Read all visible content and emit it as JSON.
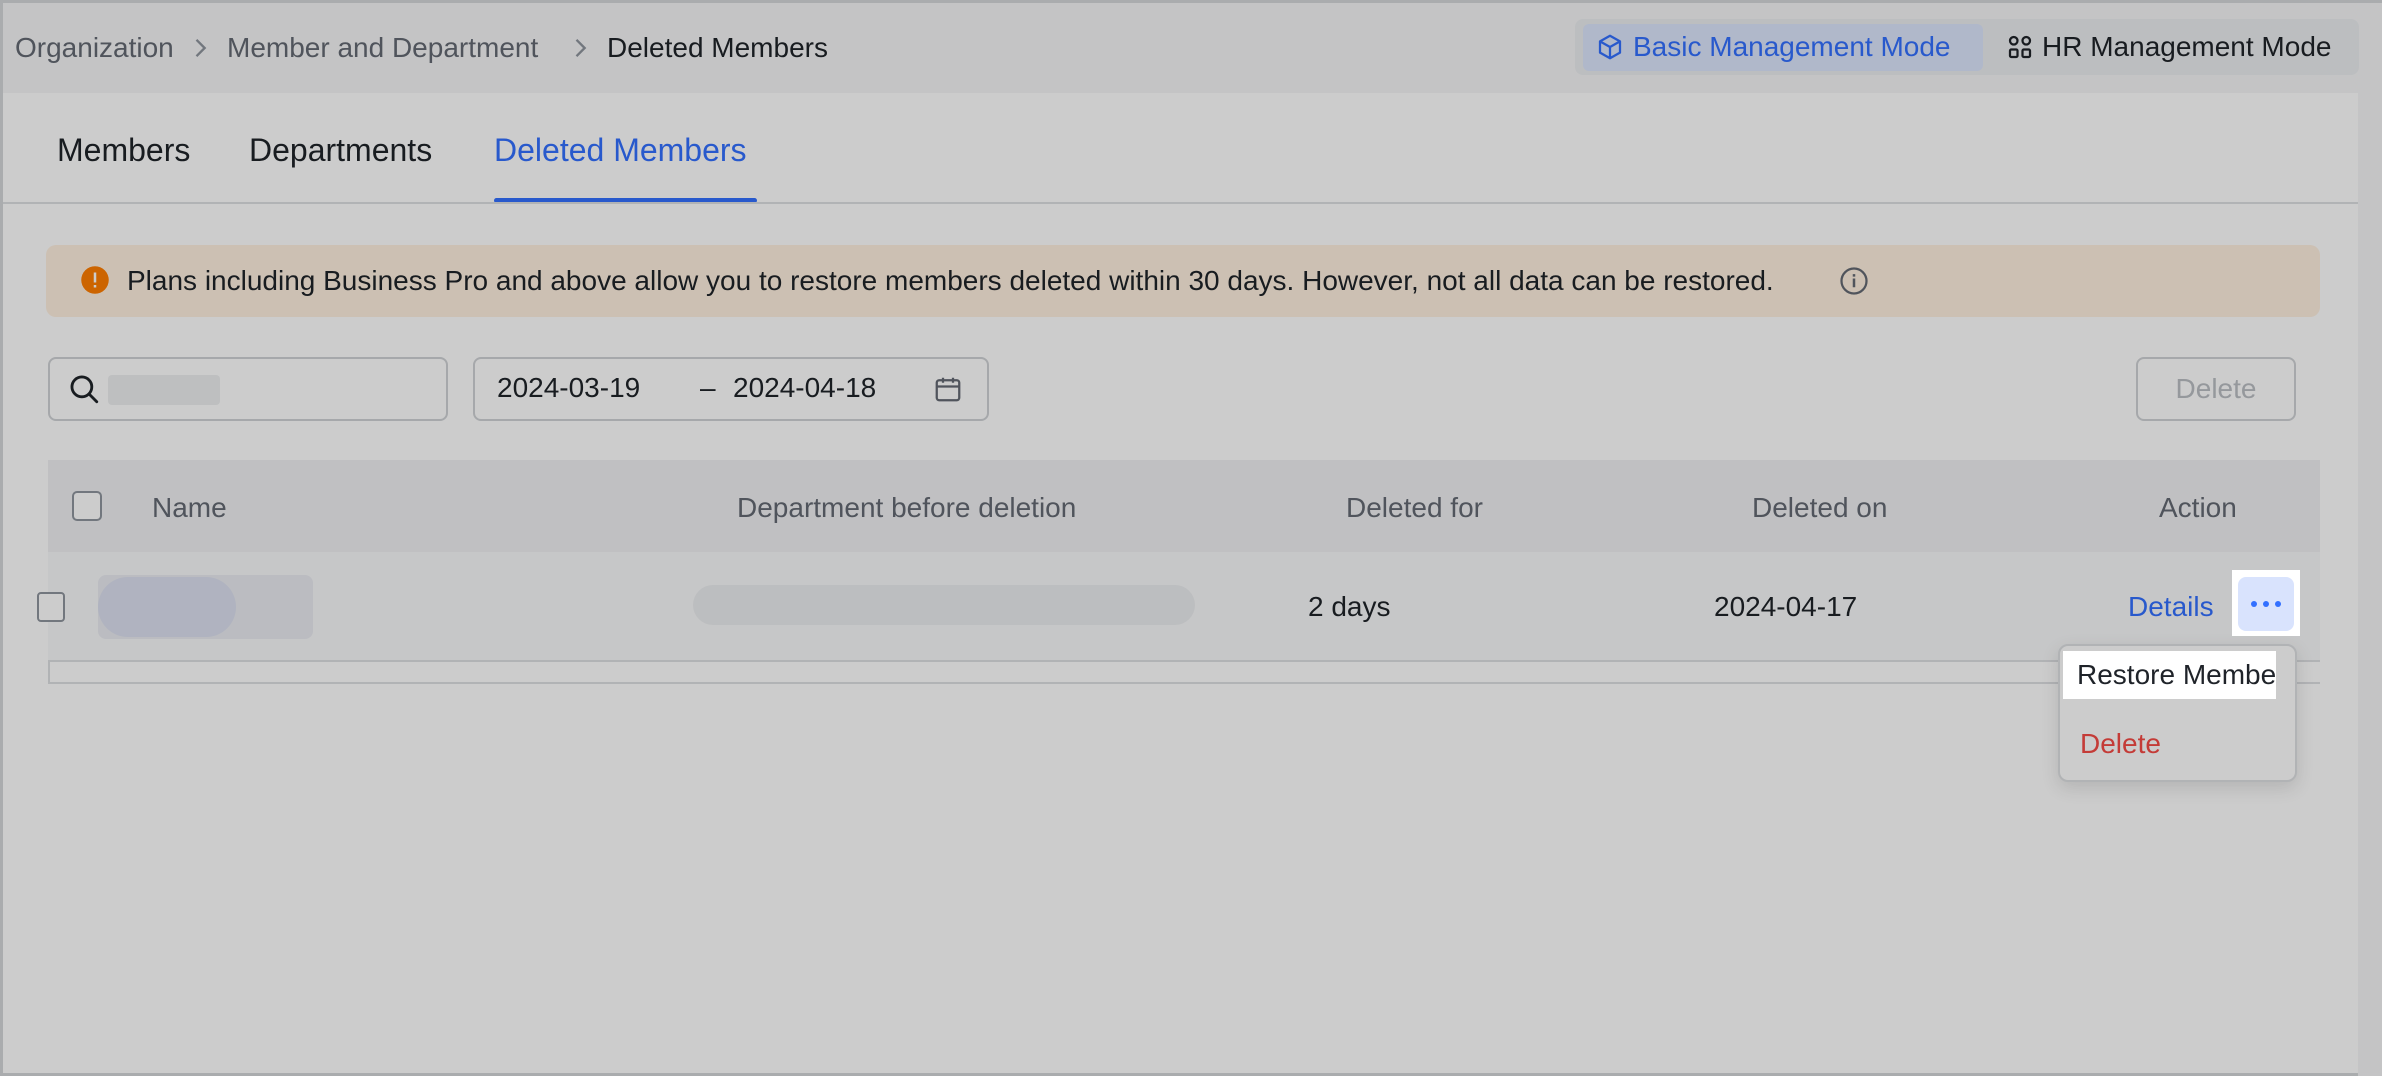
{
  "breadcrumb": {
    "items": [
      "Organization",
      "Member and Department",
      "Deleted Members"
    ]
  },
  "modes": {
    "basic_label": "Basic Management Mode",
    "hr_label": "HR Management Mode",
    "basic_icon": "cube-icon",
    "hr_icon": "grid-people-icon"
  },
  "tabs": [
    {
      "label": "Members"
    },
    {
      "label": "Departments"
    },
    {
      "label": "Deleted Members",
      "active": true
    }
  ],
  "notice": {
    "text": "Plans including Business Pro and above allow you to restore members deleted within 30 days. However, not all data can be restored.",
    "icon": "warning-icon",
    "info_icon": "info-icon"
  },
  "filters": {
    "date_start": "2024-03-19",
    "date_sep": "–",
    "date_end": "2024-04-18",
    "delete_label": "Delete"
  },
  "table": {
    "columns": [
      "Name",
      "Department before deletion",
      "Deleted for",
      "Deleted on",
      "Action"
    ],
    "rows": [
      {
        "deleted_for": "2 days",
        "deleted_on": "2024-04-17",
        "details_label": "Details"
      }
    ]
  },
  "menu": {
    "restore_label": "Restore Member",
    "delete_label": "Delete"
  },
  "colors": {
    "accent": "#3370ff",
    "danger": "#f54a45",
    "notice_bg": "#fff1e0",
    "warning": "#ff7d00"
  }
}
